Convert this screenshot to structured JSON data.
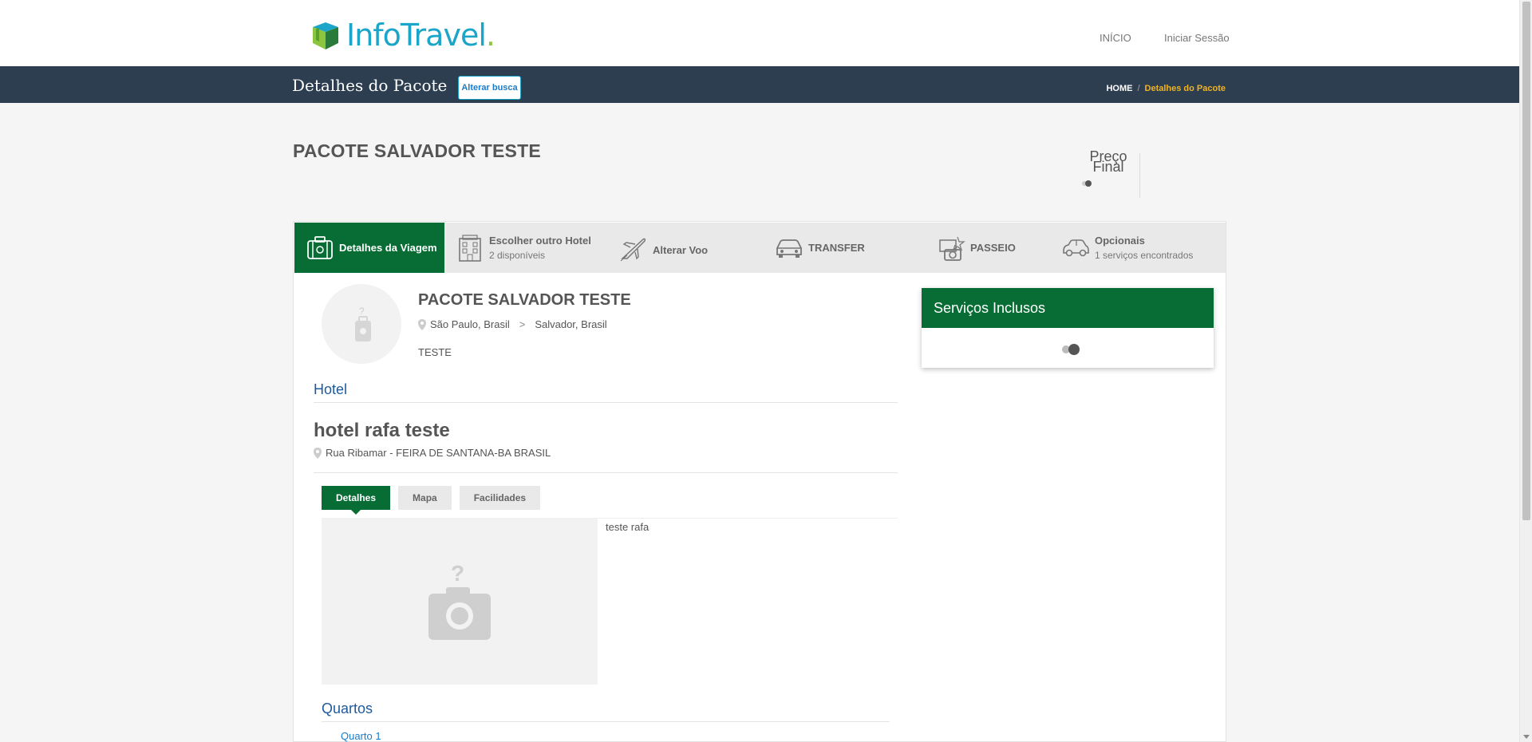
{
  "header": {
    "logo_prefix": "Info",
    "logo_suffix": "Travel",
    "logo_dot": ".",
    "nav": [
      {
        "label": "INÍCIO"
      },
      {
        "label": "Iniciar Sessão"
      }
    ]
  },
  "subheader": {
    "title": "Detalhes do Pacote",
    "alter_button": "Alterar busca",
    "breadcrumb": {
      "home": "HOME",
      "separator": "/",
      "current": "Detalhes do Pacote"
    }
  },
  "package": {
    "title": "PACOTE SALVADOR TESTE",
    "price_label_line1": "Preço",
    "price_label_line2": "Final"
  },
  "tabs": [
    {
      "label": "Detalhes da Viagem",
      "sub": "",
      "icon": "luggage-icon"
    },
    {
      "label": "Escolher outro Hotel",
      "sub": "2 disponíveis",
      "icon": "hotel-icon"
    },
    {
      "label": "Alterar Voo",
      "sub": "",
      "icon": "plane-icon"
    },
    {
      "label": "TRANSFER",
      "sub": "",
      "icon": "car-icon"
    },
    {
      "label": "PASSEIO",
      "sub": "",
      "icon": "tour-icon"
    },
    {
      "label": "Opcionais",
      "sub": "1 serviços encontrados",
      "icon": "car-outline-icon"
    }
  ],
  "details": {
    "package_name": "PACOTE SALVADOR TESTE",
    "origin": "São Paulo, Brasil",
    "route_separator": ">",
    "destination": "Salvador, Brasil",
    "description": "TESTE",
    "hotel_section_title": "Hotel",
    "hotel_name": "hotel rafa teste",
    "hotel_address": "Rua Ribamar - FEIRA DE SANTANA-BA BRASIL",
    "hotel_tabs": [
      {
        "label": "Detalhes"
      },
      {
        "label": "Mapa"
      },
      {
        "label": "Facilidades"
      }
    ],
    "hotel_description": "teste rafa",
    "rooms_title": "Quartos",
    "rooms": [
      {
        "label": "Quarto 1"
      }
    ]
  },
  "services_panel": {
    "title": "Serviços Inclusos"
  },
  "colors": {
    "brand_green": "#086d34",
    "dark_bar": "#2c3e50",
    "accent_blue": "#1aa5c9",
    "breadcrumb_current": "#f0b323"
  }
}
